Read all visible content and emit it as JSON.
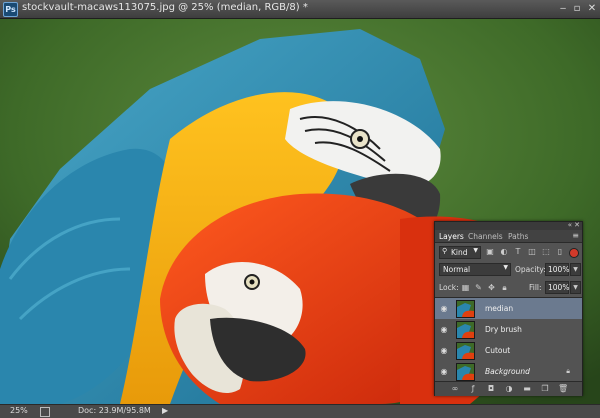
{
  "window": {
    "ps_logo": "Ps",
    "title": "stockvault-macaws113075.jpg @ 25% (median, RGB/8) *"
  },
  "status_bar": {
    "zoom": "25%",
    "doc_size": "Doc: 23.9M/95.8M"
  },
  "layers_panel": {
    "tabs": [
      "Layers",
      "Channels",
      "Paths"
    ],
    "filter_kind": "Kind",
    "blend_mode": "Normal",
    "opacity_label": "Opacity:",
    "opacity_value": "100%",
    "lock_label": "Lock:",
    "fill_label": "Fill:",
    "fill_value": "100%",
    "layers": [
      {
        "name": "median",
        "selected": true
      },
      {
        "name": "Dry brush",
        "selected": false
      },
      {
        "name": "Cutout",
        "selected": false
      },
      {
        "name": "Background",
        "selected": false,
        "locked": true
      }
    ]
  },
  "colors": {
    "selected_layer": "#6b7a8f",
    "panel_bg": "#535353"
  }
}
